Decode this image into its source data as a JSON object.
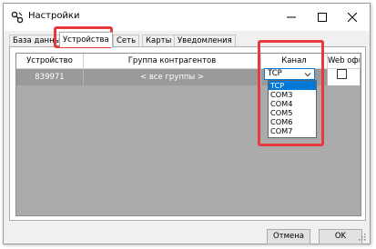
{
  "window": {
    "title": "Настройки"
  },
  "tabs": [
    "База данных",
    "Устройства",
    "Сеть",
    "Карты",
    "Уведомления"
  ],
  "active_tab": "Устройства",
  "table": {
    "columns": [
      "Устройство",
      "Группа контрагентов",
      "Канал",
      "Web офис"
    ],
    "rows": [
      {
        "device": "839971",
        "group": "< все группы >",
        "channel": "TCP",
        "web_office": false
      }
    ]
  },
  "channel_dropdown": {
    "selected": "TCP",
    "options": [
      "TCP",
      "COM3",
      "COM4",
      "COM5",
      "COM6",
      "COM7"
    ]
  },
  "buttons": {
    "cancel": "Отмена",
    "ok": "OK"
  },
  "colors": {
    "highlight": "#e8393c",
    "selection": "#0078d7",
    "row_selected": "#9a9a9a"
  },
  "icons": {
    "app": "settings-app-icon",
    "minimize": "minimize-icon",
    "maximize": "maximize-icon",
    "close": "close-icon"
  }
}
